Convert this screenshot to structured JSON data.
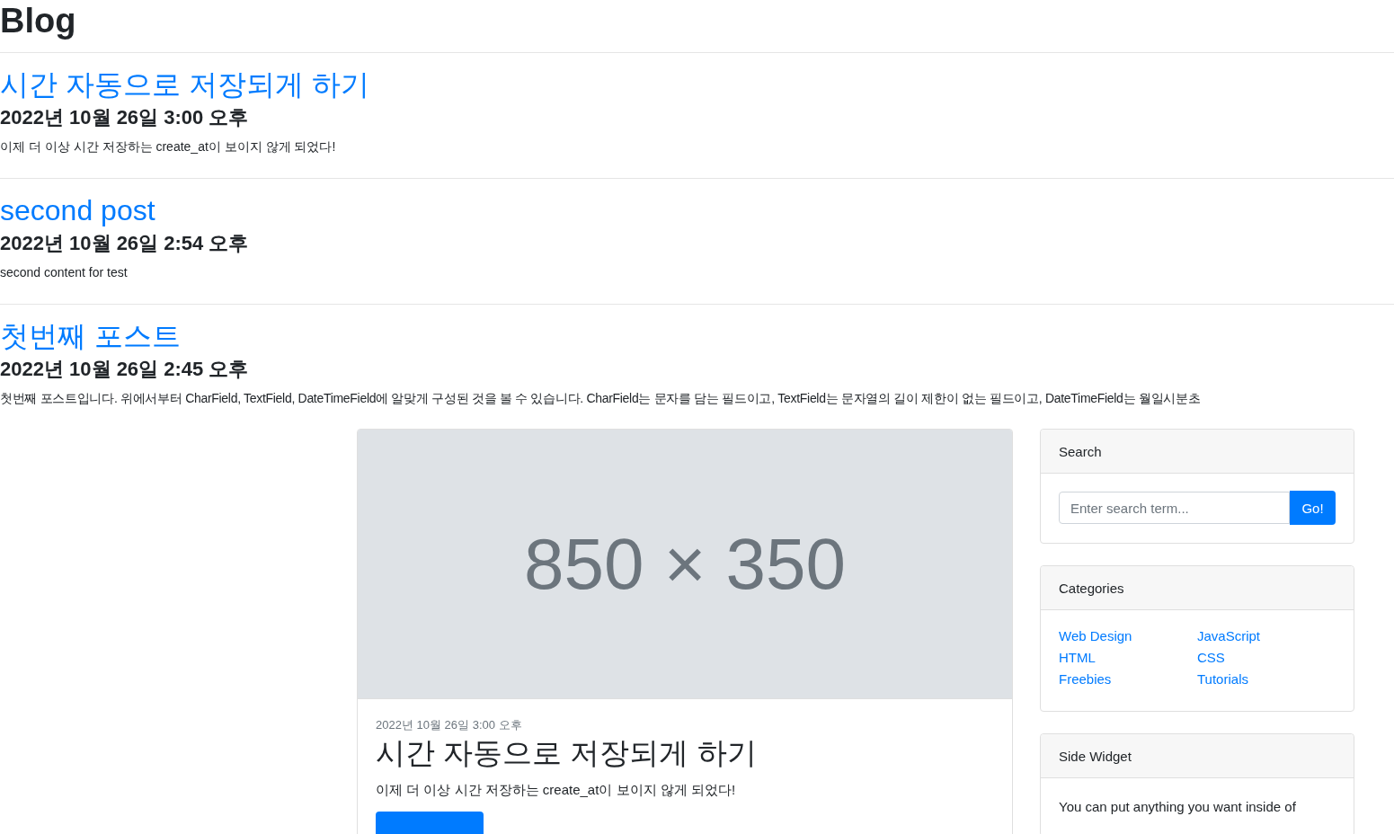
{
  "page_title": "Blog",
  "posts": [
    {
      "title": "시간 자동으로 저장되게 하기",
      "date": "2022년 10월 26일 3:00 오후",
      "content": "이제 더 이상 시간 저장하는 create_at이 보이지 않게 되었다!"
    },
    {
      "title": "second post",
      "date": "2022년 10월 26일 2:54 오후",
      "content": "second content for test"
    },
    {
      "title": "첫번째 포스트",
      "date": "2022년 10월 26일 2:45 오후",
      "content": "첫번째 포스트입니다. 위에서부터 CharField, TextField, DateTimeField에 알맞게 구성된 것을 볼 수 있습니다. CharField는 문자를 담는 필드이고, TextField는 문자열의 길이 제한이 없는 필드이고, DateTimeField는 월일시분초"
    }
  ],
  "card": {
    "image_label": "850 × 350",
    "date": "2022년 10월 26일 3:00 오후",
    "title": "시간 자동으로 저장되게 하기",
    "text": "이제 더 이상 시간 저장하는 create_at이 보이지 않게 되었다!"
  },
  "sidebar": {
    "search": {
      "title": "Search",
      "placeholder": "Enter search term...",
      "button": "Go!"
    },
    "categories": {
      "title": "Categories",
      "items": [
        "Web Design",
        "HTML",
        "Freebies",
        "JavaScript",
        "CSS",
        "Tutorials"
      ]
    },
    "widget": {
      "title": "Side Widget",
      "text": "You can put anything you want inside of"
    }
  }
}
